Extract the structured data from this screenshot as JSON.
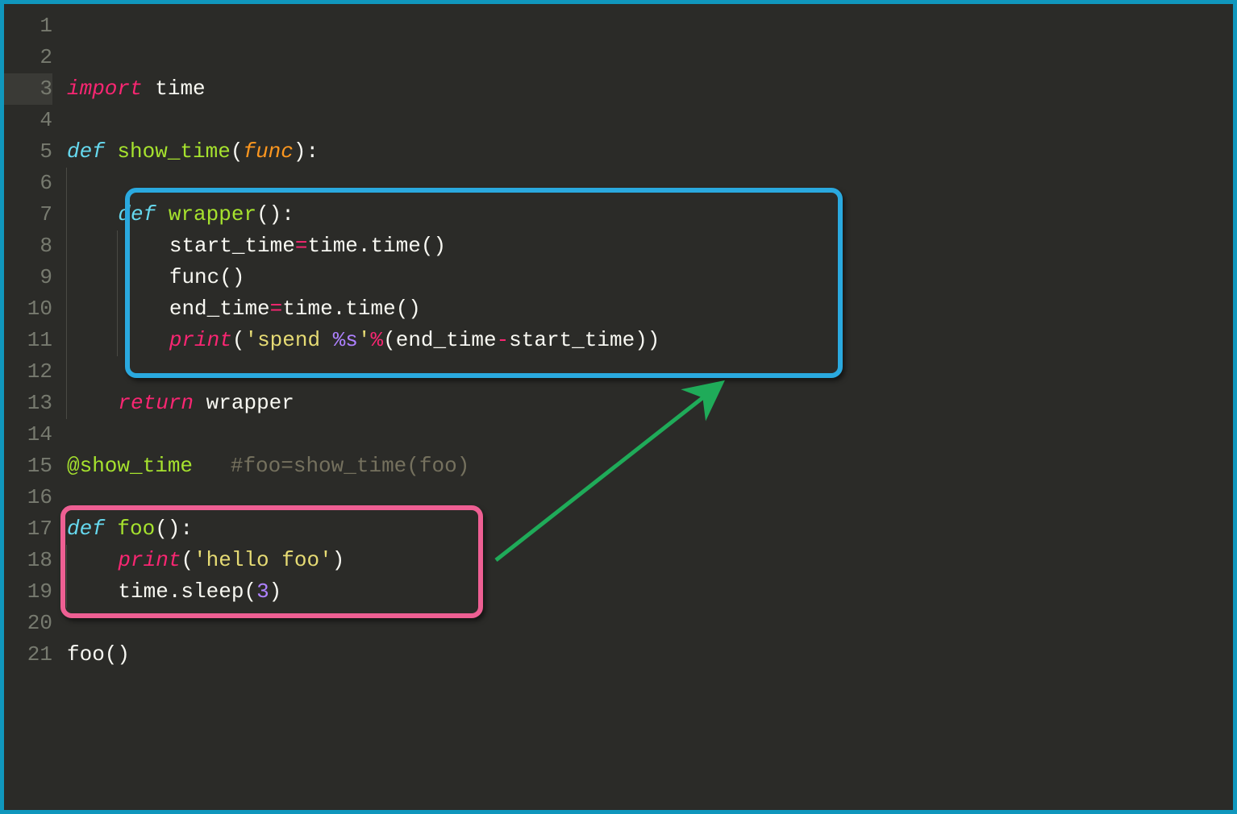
{
  "gutter": {
    "lines": [
      "1",
      "2",
      "3",
      "4",
      "5",
      "6",
      "7",
      "8",
      "9",
      "10",
      "11",
      "12",
      "13",
      "14",
      "15",
      "16",
      "17",
      "18",
      "19",
      "20",
      "21"
    ],
    "current_line": 3
  },
  "code": {
    "l3": {
      "import": "import",
      "sp": " ",
      "time": "time"
    },
    "l5": {
      "def": "def",
      "sp": " ",
      "name": "show_time",
      "lp": "(",
      "param": "func",
      "rp": "):"
    },
    "l7": {
      "def": "def",
      "sp": " ",
      "name": "wrapper",
      "paren": "():"
    },
    "l8": {
      "lhs": "start_time",
      "eq": "=",
      "rhs": "time.time()"
    },
    "l9": {
      "call": "func()"
    },
    "l10": {
      "lhs": "end_time",
      "eq": "=",
      "rhs": "time.time()"
    },
    "l11": {
      "print": "print",
      "lp": "(",
      "s1": "'spend ",
      "fmt": "%s",
      "s2": "'",
      "pct": "%",
      "open": "(end_time",
      "minus": "-",
      "close": "start_time))"
    },
    "l13": {
      "ret": "return",
      "sp": " ",
      "val": "wrapper"
    },
    "l15": {
      "dec": "@show_time",
      "pad": "   ",
      "comment": "#foo=show_time(foo)"
    },
    "l17": {
      "def": "def",
      "sp": " ",
      "name": "foo",
      "paren": "():"
    },
    "l18": {
      "print": "print",
      "lp": "(",
      "str": "'hello foo'",
      "rp": ")"
    },
    "l19": {
      "obj": "time.sleep(",
      "num": "3",
      "rp": ")"
    },
    "l21": {
      "call": "foo()"
    }
  }
}
